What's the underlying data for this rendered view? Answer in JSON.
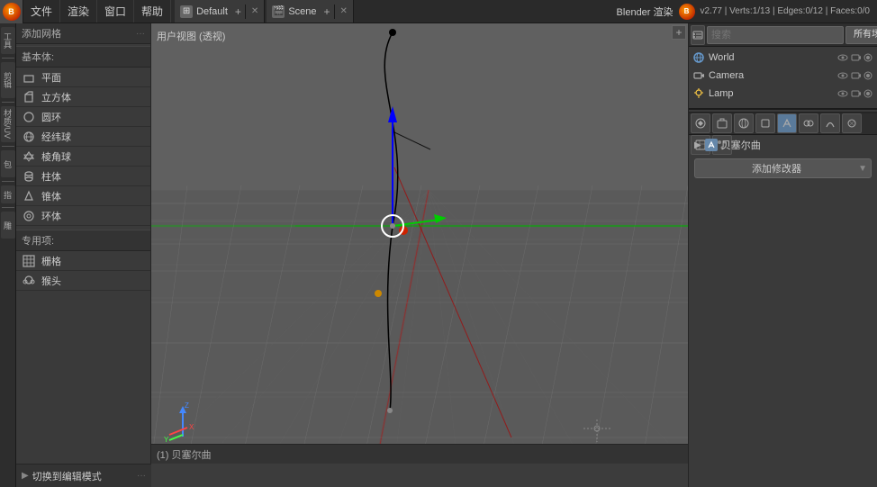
{
  "topbar": {
    "icon": "🔷",
    "menus": [
      "文件",
      "渲染",
      "窗口",
      "帮助"
    ],
    "workspace1_icon": "⊞",
    "workspace1_label": "Default",
    "workspace2_icon": "🎬",
    "workspace2_label": "Scene",
    "blender_label": "Blender 渲染",
    "version": "v2.77 | Verts:1/13 | Edges:0/12 | Faces:0/0"
  },
  "left_panel": {
    "header": "添加网格",
    "basic_label": "基本体:",
    "items": [
      {
        "label": "平面",
        "icon": "▭"
      },
      {
        "label": "立方体",
        "icon": "⬜"
      },
      {
        "label": "圆环",
        "icon": "○"
      },
      {
        "label": "经纬球",
        "icon": "◎"
      },
      {
        "label": "棱角球",
        "icon": "◇"
      },
      {
        "label": "柱体",
        "icon": "⬡"
      },
      {
        "label": "锥体",
        "icon": "△"
      },
      {
        "label": "环体",
        "icon": "⊙"
      }
    ],
    "special_label": "专用项:",
    "special_items": [
      {
        "label": "栅格",
        "icon": "⊞"
      },
      {
        "label": "猴头",
        "icon": "🐵"
      }
    ],
    "bottom_label": "切换到编辑模式"
  },
  "viewport": {
    "label": "用户视图 (透视)",
    "status_label": "(1) 贝塞尔曲"
  },
  "right_panel": {
    "search_placeholder": "搜索",
    "filter_label": "所有场景",
    "outliner": [
      {
        "label": "World",
        "icon": "🌐",
        "indent": false,
        "selected": false
      },
      {
        "label": "Camera",
        "icon": "📷",
        "indent": false,
        "selected": false
      },
      {
        "label": "Lamp",
        "icon": "💡",
        "indent": false,
        "selected": false
      }
    ],
    "prop_buttons": [
      "⚙",
      "📷",
      "🔧",
      "🎨",
      "📦",
      "⚡",
      "🔗",
      "👁",
      "🔵",
      "🌟"
    ],
    "modifier_label": "贝塞尔曲",
    "add_modifier_label": "添加修改器"
  }
}
